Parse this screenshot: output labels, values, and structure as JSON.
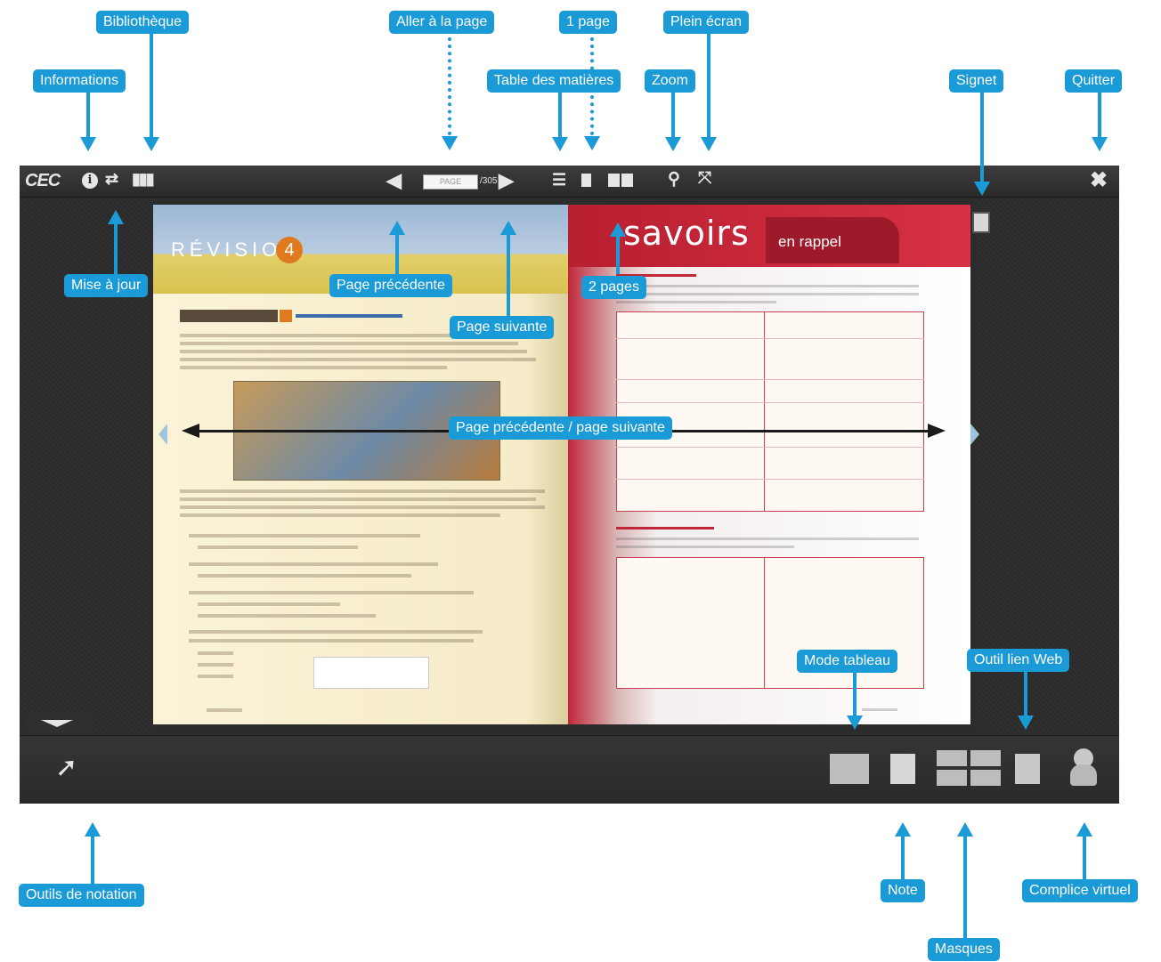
{
  "labels": {
    "informations": "Informations",
    "bibliotheque": "Bibliothèque",
    "aller_page": "Aller à la page",
    "un_page": "1 page",
    "plein_ecran": "Plein écran",
    "table_matieres": "Table des matières",
    "zoom": "Zoom",
    "signet": "Signet",
    "quitter": "Quitter",
    "mise_a_jour": "Mise à jour",
    "page_precedente": "Page précédente",
    "deux_pages": "2 pages",
    "page_suivante": "Page suivante",
    "prec_suiv": "Page précédente / page suivante",
    "mode_tableau": "Mode tableau",
    "outil_lien_web": "Outil lien Web",
    "outils_notation": "Outils de notation",
    "note": "Note",
    "complice_virtuel": "Complice virtuel",
    "masques": "Masques"
  },
  "toolbar": {
    "logo": "CEC",
    "page_placeholder": "PAGE",
    "page_total": "/305"
  },
  "book": {
    "left_title": "RÉVISION",
    "left_number": "4",
    "right_title": "savoirs",
    "right_subtitle": "en rappel"
  },
  "colors": {
    "annotation": "#1a9ad6",
    "chrome": "#2c2c2c",
    "accent_red": "#c0283a"
  },
  "icons": [
    "info-icon",
    "sync-icon",
    "library-icon",
    "prev-arrow-icon",
    "next-arrow-icon",
    "toc-icon",
    "one-page-icon",
    "two-pages-icon",
    "zoom-icon",
    "fullscreen-icon",
    "close-icon",
    "bookmark-icon",
    "pointer-icon",
    "board-mode-icon",
    "note-icon",
    "masks-icon",
    "web-link-icon",
    "virtual-assistant-icon"
  ]
}
